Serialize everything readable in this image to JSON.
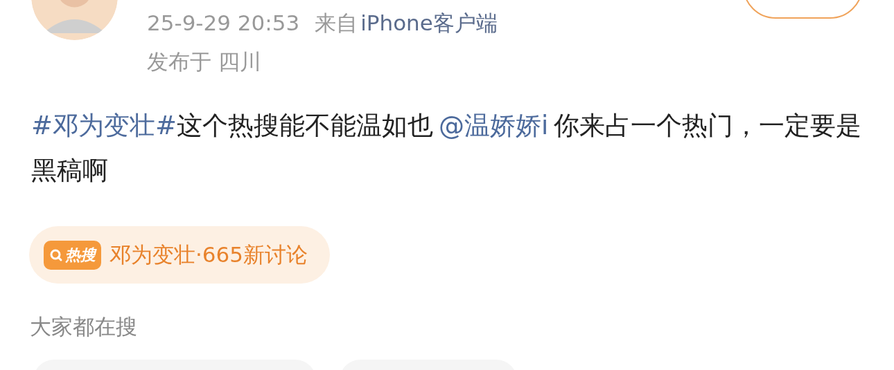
{
  "meta": {
    "time": "25-9-29 20:53",
    "source_prefix": "来自",
    "source": "iPhone客户端",
    "location": "发布于 四川"
  },
  "post": {
    "segments": [
      {
        "kind": "topic",
        "text": "#邓为变壮#"
      },
      {
        "kind": "text",
        "text": "这个热搜能不能温如也"
      },
      {
        "kind": "mention",
        "text": "@温娇娇i"
      },
      {
        "kind": "text",
        "text": "你来占一个热门，一定要是黑稿啊"
      }
    ]
  },
  "hot_search": {
    "badge": "热搜",
    "text": "邓为变壮·665新讨论"
  },
  "section_title": "大家都在搜"
}
